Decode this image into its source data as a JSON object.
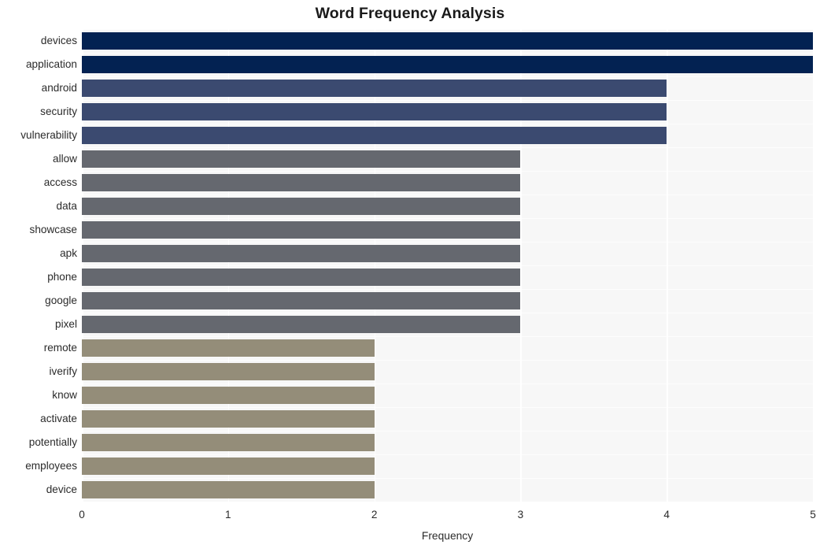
{
  "chart_data": {
    "type": "bar",
    "orientation": "horizontal",
    "title": "Word Frequency Analysis",
    "xlabel": "Frequency",
    "ylabel": "",
    "xlim": [
      0,
      5
    ],
    "xticks": [
      0,
      1,
      2,
      3,
      4,
      5
    ],
    "xtick_labels": [
      "0",
      "1",
      "2",
      "3",
      "4",
      "5"
    ],
    "grid": true,
    "grid_color": "#ffffff",
    "plot_background": "#f7f7f7",
    "figure_background": "#ffffff",
    "legend": null,
    "categories": [
      "devices",
      "application",
      "android",
      "security",
      "vulnerability",
      "allow",
      "access",
      "data",
      "showcase",
      "apk",
      "phone",
      "google",
      "pixel",
      "remote",
      "iverify",
      "know",
      "activate",
      "potentially",
      "employees",
      "device"
    ],
    "values": [
      5,
      5,
      4,
      4,
      4,
      3,
      3,
      3,
      3,
      3,
      3,
      3,
      3,
      2,
      2,
      2,
      2,
      2,
      2,
      2
    ],
    "bar_colors": [
      "#032252",
      "#032252",
      "#3b4a70",
      "#3b4a70",
      "#3b4a70",
      "#65686f",
      "#65686f",
      "#65686f",
      "#65686f",
      "#65686f",
      "#65686f",
      "#65686f",
      "#65686f",
      "#948d79",
      "#948d79",
      "#948d79",
      "#948d79",
      "#948d79",
      "#948d79",
      "#948d79"
    ],
    "palette": {
      "freq_5": "#032252",
      "freq_4": "#3b4a70",
      "freq_3": "#65686f",
      "freq_2": "#948d79"
    }
  }
}
